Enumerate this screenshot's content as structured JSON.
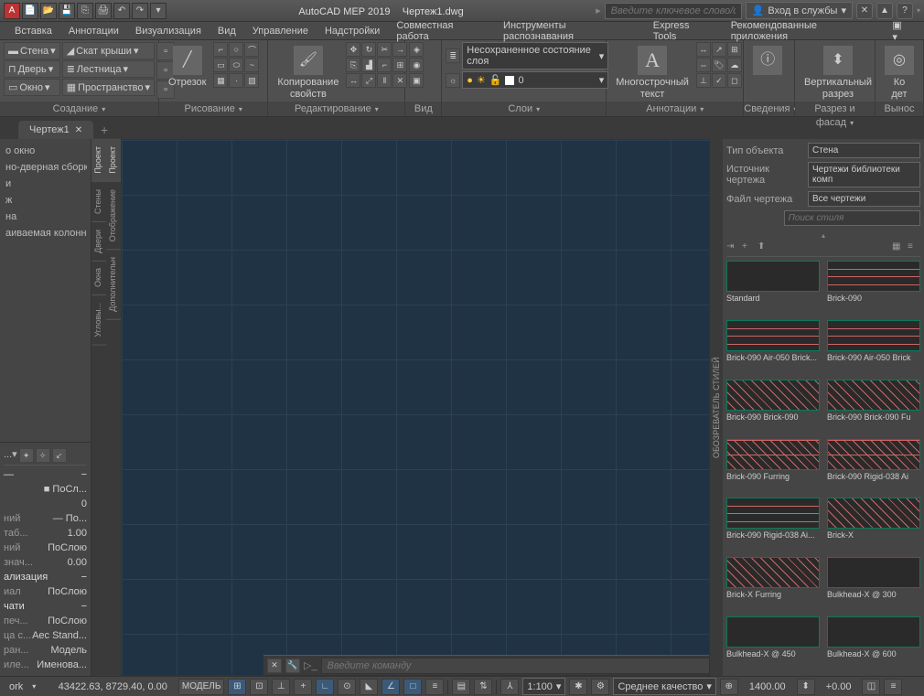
{
  "title": {
    "app": "AutoCAD MEP 2019",
    "file": "Чертеж1.dwg"
  },
  "search_placeholder": "Введите ключевое слово/фразу",
  "signin": "Вход в службы",
  "menus": [
    "Вставка",
    "Аннотации",
    "Визуализация",
    "Вид",
    "Управление",
    "Надстройки",
    "Совместная работа",
    "Инструменты распознавания",
    "Express Tools",
    "Рекомендованные приложения"
  ],
  "ribbon": {
    "create": {
      "title": "Создание",
      "wall": "Стена",
      "door": "Дверь",
      "window": "Окно",
      "roofslope": "Скат крыши",
      "stair": "Лестница",
      "space": "Пространство"
    },
    "draw": {
      "title": "Рисование",
      "segment": "Отрезок"
    },
    "edit": {
      "title": "Редактирование",
      "copyprops": "Копирование\nсвойств"
    },
    "view": {
      "title": "Вид"
    },
    "layers": {
      "title": "Слои",
      "unsaved": "Несохраненное состояние слоя",
      "zero": "0"
    },
    "annot": {
      "title": "Аннотации",
      "mtext": "Многострочный\nтекст"
    },
    "info": {
      "title": "Сведения"
    },
    "section": {
      "title": "Разрез и фасад",
      "vert": "Вертикальный\nразрез"
    },
    "callout": {
      "title": "Вынос",
      "co": "Ко\nдет"
    }
  },
  "filetab": "Чертеж1",
  "toolpalette": {
    "items": [
      "о окно",
      "но-дверная сборка",
      "и",
      "ж",
      "на",
      "аиваемая колонна"
    ],
    "sidetabs": [
      "Проект",
      "Стены",
      "Двери",
      "Окна",
      "Угловы..."
    ]
  },
  "props": {
    "sidetabs": [
      "Проект",
      "Отображение",
      "Дополнительн"
    ],
    "color_lbl": "",
    "color_v": "■ ПоСл...",
    "layer_v": "0",
    "linetype_lbl": "ний",
    "linetype_v": "— По...",
    "scale_lbl": "таб...",
    "scale_v": "1.00",
    "weight_lbl": "ний",
    "weight_v": "ПоСлою",
    "trans_lbl": "знач...",
    "trans_v": "0.00",
    "viz_section": "ализация",
    "mat_lbl": "иал",
    "mat_v": "ПоСлою",
    "print_section": "чати",
    "ps_lbl": "печ...",
    "ps_v": "ПоСлою",
    "pt_lbl": "ца с...",
    "pt_v": "Aec Stand...",
    "sp_lbl": "ран...",
    "sp_v": "Модель",
    "hl_lbl": "иле...",
    "hl_v": "Именова..."
  },
  "styles": {
    "side_title": "ОБОЗРЕВАТЕЛЬ СТИЛЕЙ",
    "type_lbl": "Тип объекта",
    "type_v": "Стена",
    "src_lbl": "Источник чертежа",
    "src_v": "Чертежи библиотеки комп",
    "file_lbl": "Файл чертежа",
    "file_v": "Все чертежи",
    "search": "Поиск стиля",
    "items": [
      {
        "n": "Standard",
        "p": "blank"
      },
      {
        "n": "Brick-090",
        "p": "brick"
      },
      {
        "n": "Brick-090 Air-050 Brick...",
        "p": "brick"
      },
      {
        "n": "Brick-090 Air-050 Brick",
        "p": "brick"
      },
      {
        "n": "Brick-090 Brick-090",
        "p": "diag"
      },
      {
        "n": "Brick-090 Brick-090 Fu",
        "p": "diag"
      },
      {
        "n": "Brick-090 Furring",
        "p": "diag2"
      },
      {
        "n": "Brick-090 Rigid-038 Ai",
        "p": "diag2"
      },
      {
        "n": "Brick-090 Rigid-038 Ai...",
        "p": "brick"
      },
      {
        "n": "Brick-X",
        "p": "diag"
      },
      {
        "n": "Brick-X Furring",
        "p": "diag"
      },
      {
        "n": "Bulkhead-X @ 300",
        "p": "blank"
      },
      {
        "n": "Bulkhead-X @ 450",
        "p": "blank"
      },
      {
        "n": "Bulkhead-X @ 600",
        "p": "blank"
      }
    ]
  },
  "cmd": {
    "placeholder": "Введите команду"
  },
  "status": {
    "work": "ork",
    "coords": "43422.63, 8729.40, 0.00",
    "model": "МОДЕЛЬ",
    "scale": "1:100",
    "quality": "Среднее качество",
    "zoom": "1400.00",
    "elev": "+0.00"
  }
}
